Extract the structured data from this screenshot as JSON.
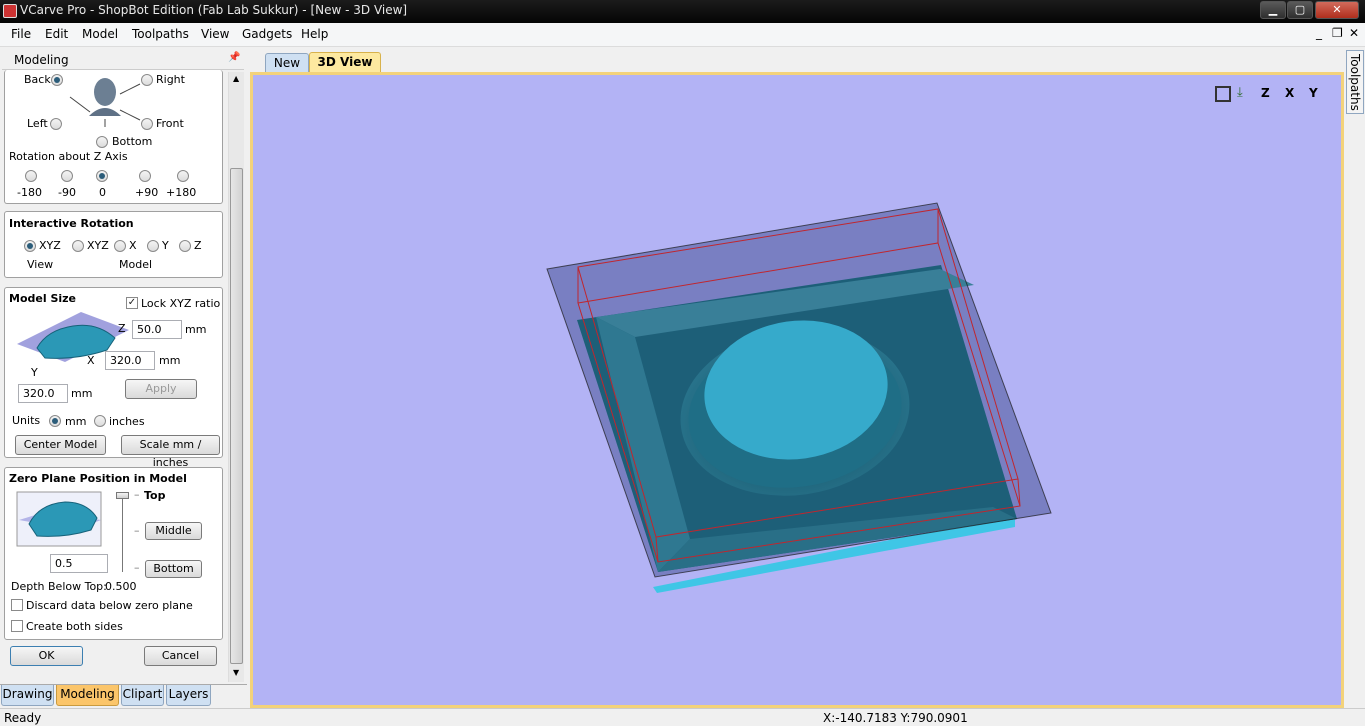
{
  "window": {
    "title": "VCarve Pro - ShopBot Edition (Fab Lab Sukkur) - [New - 3D View]",
    "minimize": "▁",
    "maximize": "▢",
    "close": "✕"
  },
  "menu": {
    "items": [
      "File",
      "Edit",
      "Model",
      "Toolpaths",
      "View",
      "Gadgets",
      "Help"
    ],
    "mdi_min": "_",
    "mdi_restore": "❐",
    "mdi_close": "✕"
  },
  "panel": {
    "title": "Modeling",
    "pin": "📌",
    "view_dirs": {
      "back": "Back",
      "right": "Right",
      "left": "Left",
      "front": "Front",
      "bottom": "Bottom"
    },
    "rotz": {
      "title": "Rotation about Z Axis",
      "options": [
        "-180",
        "-90",
        "0",
        "+90",
        "+180"
      ]
    },
    "interactive": {
      "title": "Interactive Rotation",
      "options": [
        "XYZ",
        "XYZ",
        "X",
        "Y",
        "Z"
      ],
      "view_label": "View",
      "model_label": "Model"
    },
    "model_size": {
      "title": "Model Size",
      "lock": "Lock XYZ ratio",
      "z": "50.0",
      "x": "320.0",
      "y": "320.0",
      "mm": "mm",
      "apply": "Apply",
      "axis_z": "Z",
      "axis_x": "X",
      "axis_y": "Y",
      "units_label": "Units",
      "unit_mm": "mm",
      "unit_in": "inches",
      "center": "Center Model",
      "scale": "Scale mm / inches"
    },
    "zero_plane": {
      "title": "Zero Plane Position in Model",
      "top": "Top",
      "middle": "Middle",
      "bottom": "Bottom",
      "value": "0.5",
      "depth_label": "Depth Below Top:",
      "depth_value": "0.500",
      "discard": "Discard data below zero plane",
      "both_sides": "Create both sides"
    },
    "ok": "OK",
    "cancel": "Cancel",
    "tabs": [
      "Drawing",
      "Modeling",
      "Clipart",
      "Layers"
    ]
  },
  "doc_tabs": [
    "New",
    "3D View"
  ],
  "side_tab": "Toolpaths",
  "view_icons": [
    "zoom-extents",
    "iso-view",
    "top-view",
    "front-view",
    "side-view"
  ],
  "view_icon_labels": [
    "X",
    "Y",
    "Z"
  ],
  "status": {
    "left": "Ready",
    "coords": "X:-140.7183 Y:790.0901"
  },
  "colors": {
    "viewport": "#b3b3f5",
    "model": "#2e8fb0",
    "active_tab": "#fde9a0"
  }
}
